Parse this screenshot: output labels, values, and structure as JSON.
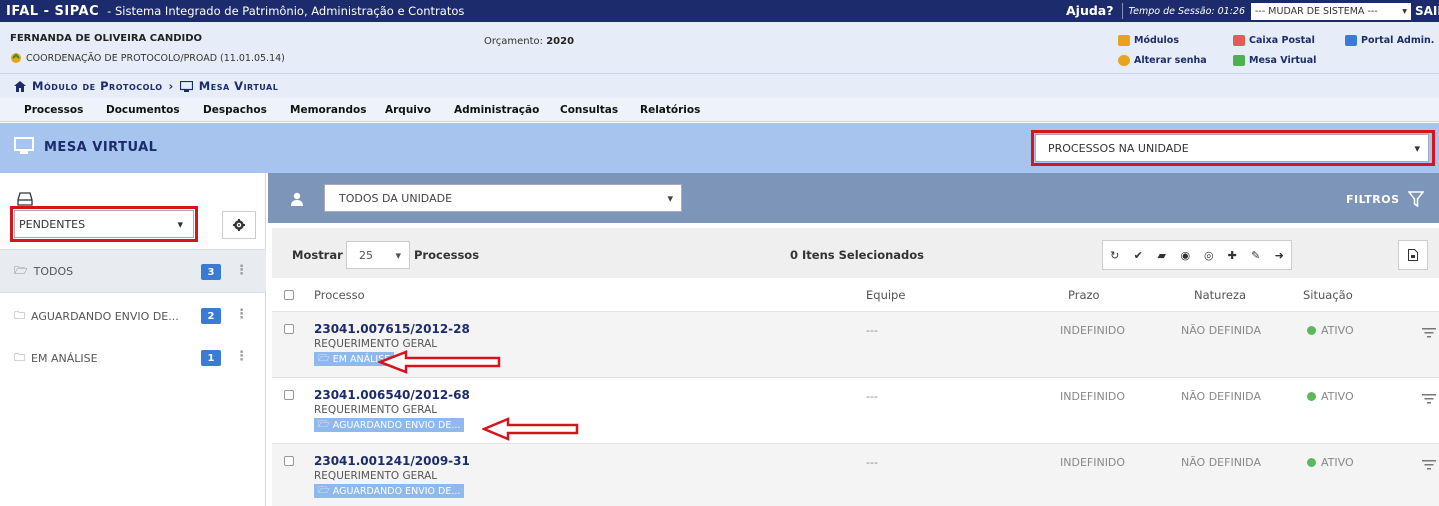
{
  "topbar": {
    "brand": "IFAL - SIPAC",
    "system_name": "- Sistema Integrado de Patrimônio, Administração e Contratos",
    "help": "Ajuda?",
    "session": "Tempo de Sessão: 01:26",
    "change_system": "--- MUDAR DE SISTEMA ---",
    "exit": "SAIR"
  },
  "user": {
    "name": "FERNANDA DE OLIVEIRA CANDIDO",
    "unit": "COORDENAÇÃO DE PROTOCOLO/PROAD (11.01.05.14)",
    "budget_label": "Orçamento:",
    "budget_year": "2020"
  },
  "quick_links": {
    "modulos": "Módulos",
    "caixa_postal": "Caixa Postal",
    "portal_admin": "Portal Admin.",
    "alterar_senha": "Alterar senha",
    "mesa_virtual": "Mesa Virtual"
  },
  "breadcrumb": {
    "module": "Módulo de Protocolo",
    "page": "Mesa Virtual"
  },
  "menu": [
    "Processos",
    "Documentos",
    "Despachos",
    "Memorandos",
    "Arquivo",
    "Administração",
    "Consultas",
    "Relatórios"
  ],
  "header": {
    "title": "MESA VIRTUAL",
    "unit_select": "PROCESSOS NA UNIDADE"
  },
  "left_panel": {
    "status_select": "PENDENTES",
    "folders": [
      {
        "label": "TODOS",
        "count": "3"
      },
      {
        "label": "AGUARDANDO ENVIO DE...",
        "count": "2"
      },
      {
        "label": "EM ANÁLISE",
        "count": "1"
      }
    ]
  },
  "right_panel": {
    "team_select": "TODOS DA UNIDADE",
    "filters": "FILTROS",
    "show_label": "Mostrar",
    "page_size": "25",
    "processes_label": "Processos",
    "selected_count": "0 Itens Selecionados"
  },
  "table": {
    "headers": {
      "processo": "Processo",
      "equipe": "Equipe",
      "prazo": "Prazo",
      "natureza": "Natureza",
      "situacao": "Situação"
    },
    "rows": [
      {
        "number": "23041.007615/2012-28",
        "type": "REQUERIMENTO GERAL",
        "tag": "EM ANÁLISE",
        "equipe": "---",
        "prazo": "INDEFINIDO",
        "natureza": "NÃO DEFINIDA",
        "situacao": "ATIVO"
      },
      {
        "number": "23041.006540/2012-68",
        "type": "REQUERIMENTO GERAL",
        "tag": "AGUARDANDO ENVIO DE...",
        "equipe": "---",
        "prazo": "INDEFINIDO",
        "natureza": "NÃO DEFINIDA",
        "situacao": "ATIVO"
      },
      {
        "number": "23041.001241/2009-31",
        "type": "REQUERIMENTO GERAL",
        "tag": "AGUARDANDO ENVIO DE...",
        "equipe": "---",
        "prazo": "INDEFINIDO",
        "natureza": "NÃO DEFINIDA",
        "situacao": "ATIVO"
      }
    ]
  },
  "colors": {
    "topbar": "#1c2b6b",
    "header_band": "#a6c4ee",
    "filter_bar": "#7d95b8",
    "highlight": "#d6141c",
    "badge": "#3a7bd5",
    "tag": "#8fb8ec",
    "status_active": "#5cb85c"
  },
  "icons": [
    "home-icon",
    "monitor-icon",
    "inbox-icon",
    "gear-icon",
    "folder-open-icon",
    "folder-icon",
    "user-icon",
    "filter-icon",
    "refresh-icon",
    "check-icon",
    "folder-move-icon",
    "eye-icon",
    "eye-off-icon",
    "add-user-icon",
    "pencil-icon",
    "forward-icon",
    "document-icon",
    "row-menu-icon",
    "red-arrow-icon"
  ]
}
